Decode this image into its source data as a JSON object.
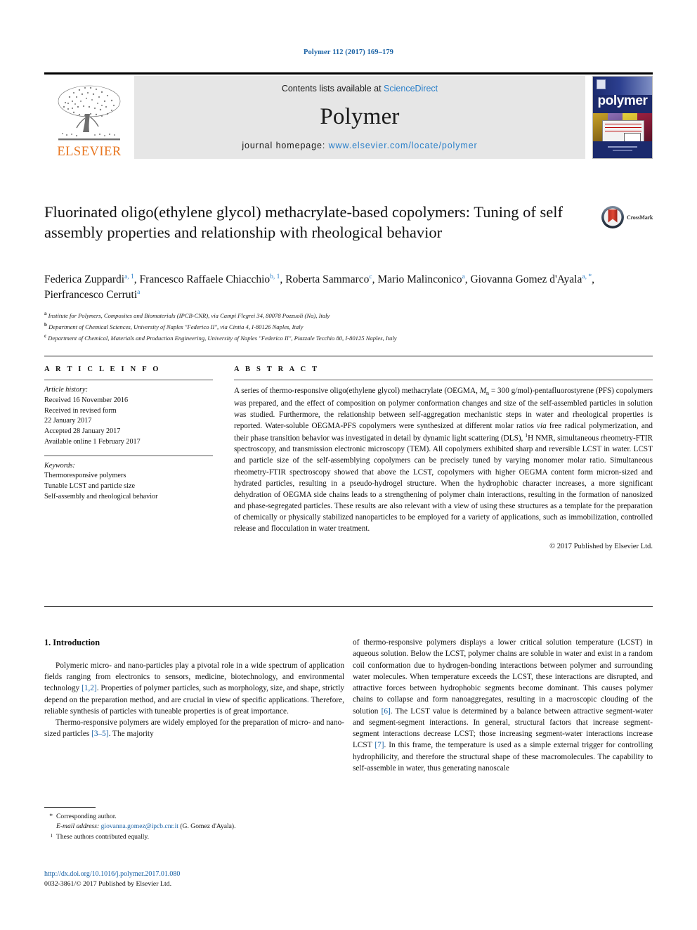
{
  "running_head": "Polymer 112 (2017) 169–179",
  "journal_header": {
    "publisher_logo_text": "ELSEVIER",
    "contents_prefix": "Contents lists available at ",
    "contents_link": "ScienceDirect",
    "journal_title": "Polymer",
    "homepage_prefix": "journal homepage: ",
    "homepage_url": "www.elsevier.com/locate/polymer",
    "cover_word": "polymer",
    "link_color": "#2a7fc9",
    "band_color": "#e6e6e6"
  },
  "crossmark": {
    "label": "CrossMark"
  },
  "article": {
    "title": "Fluorinated oligo(ethylene glycol) methacrylate-based copolymers: Tuning of self assembly properties and relationship with rheological behavior",
    "authors_line_1": "Federica Zuppardi",
    "authors": [
      {
        "name": "Federica Zuppardi",
        "marks": "a, 1"
      },
      {
        "name": "Francesco Raffaele Chiacchio",
        "marks": "b, 1"
      },
      {
        "name": "Roberta Sammarco",
        "marks": "c"
      },
      {
        "name": "Mario Malinconico",
        "marks": "a"
      },
      {
        "name": "Giovanna Gomez d'Ayala",
        "marks": "a, *"
      },
      {
        "name": "Pierfrancesco Cerruti",
        "marks": "a"
      }
    ],
    "affiliations": [
      {
        "mark": "a",
        "text": "Institute for Polymers, Composites and Biomaterials (IPCB-CNR), via Campi Flegrei 34, 80078 Pozzuoli (Na), Italy"
      },
      {
        "mark": "b",
        "text": "Department of Chemical Sciences, University of Naples \"Federico II\", via Cintia 4, I-80126 Naples, Italy"
      },
      {
        "mark": "c",
        "text": "Department of Chemical, Materials and Production Engineering, University of Naples \"Federico II\", Piazzale Tecchio 80, I-80125 Naples, Italy"
      }
    ]
  },
  "article_info": {
    "heading": "A R T I C L E   I N F O",
    "history_label": "Article history:",
    "history": [
      "Received 16 November 2016",
      "Received in revised form",
      "22 January 2017",
      "Accepted 28 January 2017",
      "Available online 1 February 2017"
    ],
    "keywords_label": "Keywords:",
    "keywords": [
      "Thermoresponsive polymers",
      "Tunable LCST and particle size",
      "Self-assembly and rheological behavior"
    ]
  },
  "abstract": {
    "heading": "A B S T R A C T",
    "paragraph_1": "A series of thermo-responsive oligo(ethylene glycol) methacrylate (OEGMA, ",
    "mn_symbol": "M",
    "mn_sub": "n",
    "paragraph_1b": " = 300 g/mol)-pentafluorostyrene (PFS) copolymers was prepared, and the effect of composition on polymer conformation changes and size of the self-assembled particles in solution was studied. Furthermore, the relationship between self-aggregation mechanistic steps in water and rheological properties is reported. Water-soluble OEGMA-PFS copolymers were synthesized at different molar ratios ",
    "via_italic": "via",
    "paragraph_1c": " free radical polymerization, and their phase transition behavior was investigated in detail by dynamic light scattering (DLS), ",
    "h_sup": "1",
    "paragraph_1d": "H NMR, simultaneous rheometry-FTIR spectroscopy, and transmission electronic microscopy (TEM). All copolymers exhibited sharp and reversible LCST in water. LCST and particle size of the self-assemblying copolymers can be precisely tuned by varying monomer molar ratio. Simultaneous rheometry-FTIR spectroscopy showed that above the LCST, copolymers with higher OEGMA content form micron-sized and hydrated particles, resulting in a pseudo-hydrogel structure. When the hydrophobic character increases, a more significant dehydration of OEGMA side chains leads to a strengthening of polymer chain interactions, resulting in the formation of nanosized and phase-segregated particles. These results are also relevant with a view of using these structures as a template for the preparation of chemically or physically stabilized nanoparticles to be employed for a variety of applications, such as immobilization, controlled release and flocculation in water treatment.",
    "copyright": "© 2017 Published by Elsevier Ltd."
  },
  "introduction": {
    "heading": "1. Introduction",
    "left_para_1_a": "Polymeric micro- and nano-particles play a pivotal role in a wide spectrum of application fields ranging from electronics to sensors, medicine, biotechnology, and environmental technology ",
    "left_ref_1": "[1,2]",
    "left_para_1_b": ". Properties of polymer particles, such as morphology, size, and shape, strictly depend on the preparation method, and are crucial in view of specific applications. Therefore, reliable synthesis of particles with tuneable properties is of great importance.",
    "left_para_2_a": "Thermo-responsive polymers are widely employed for the preparation of micro- and nano-sized particles ",
    "left_ref_2": "[3–5]",
    "left_para_2_b": ". The majority",
    "right_para_a": "of thermo-responsive polymers displays a lower critical solution temperature (LCST) in aqueous solution. Below the LCST, polymer chains are soluble in water and exist in a random coil conformation due to hydrogen-bonding interactions between polymer and surrounding water molecules. When temperature exceeds the LCST, these interactions are disrupted, and attractive forces between hydrophobic segments become dominant. This causes polymer chains to collapse and form nanoaggregates, resulting in a macroscopic clouding of the solution ",
    "right_ref_1": "[6]",
    "right_para_b": ". The LCST value is determined by a balance between attractive segment-water and segment-segment interactions. In general, structural factors that increase segment-segment interactions decrease LCST; those increasing segment-water interactions increase LCST ",
    "right_ref_2": "[7]",
    "right_para_c": ". In this frame, the temperature is used as a simple external trigger for controlling hydrophilicity, and therefore the structural shape of these macromolecules. The capability to self-assemble in water, thus generating nanoscale"
  },
  "footnotes": {
    "corresponding_mark": "*",
    "corresponding_text": "Corresponding author.",
    "email_label": "E-mail address:",
    "email": "giovanna.gomez@ipcb.cnr.it",
    "email_who": "(G. Gomez d'Ayala).",
    "equal_mark": "1",
    "equal_text": "These authors contributed equally."
  },
  "footer": {
    "doi": "http://dx.doi.org/10.1016/j.polymer.2017.01.080",
    "issn": "0032-3861/© 2017 Published by Elsevier Ltd."
  }
}
